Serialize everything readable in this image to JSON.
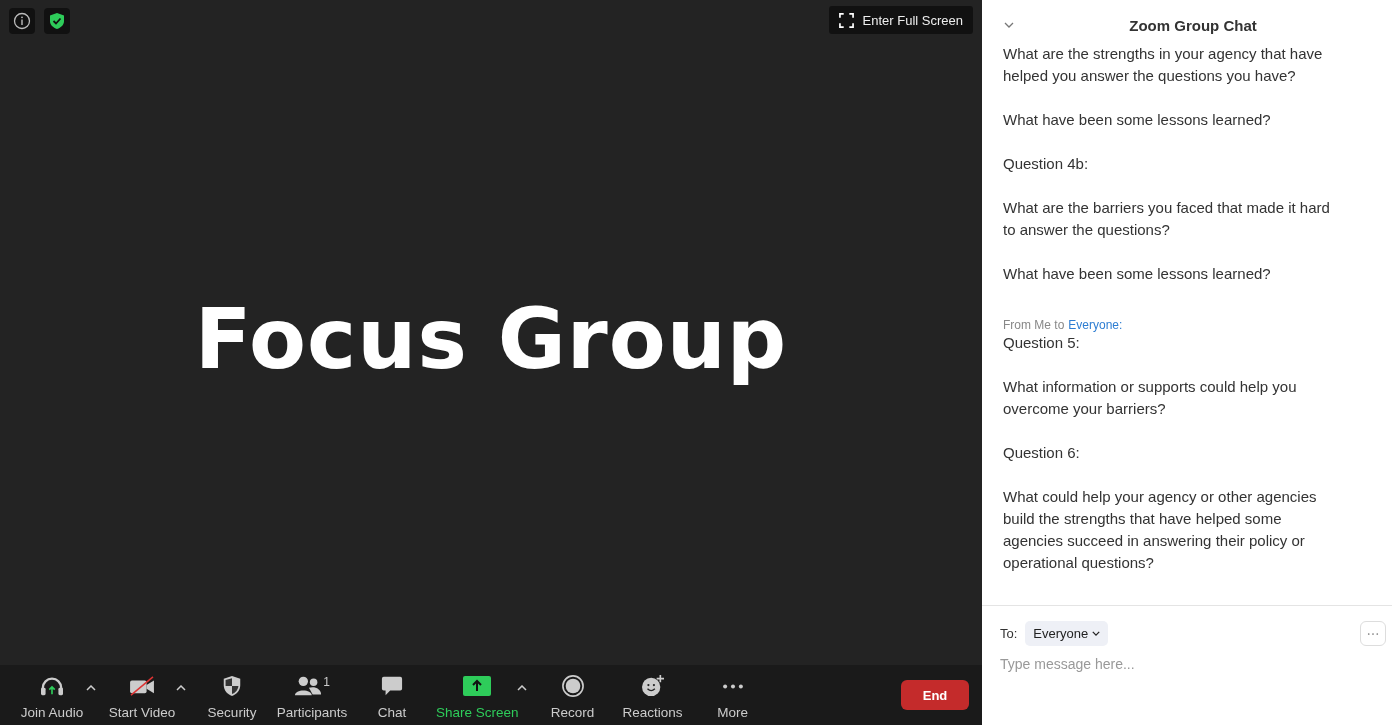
{
  "video": {
    "top_icons": [
      {
        "kind": "info"
      },
      {
        "kind": "shield"
      }
    ],
    "fullscreen_button": "Enter Full Screen",
    "title": "Focus Group"
  },
  "toolbar": [
    {
      "kind": "audio",
      "label": "Join Audio",
      "caret": true
    },
    {
      "kind": "video",
      "label": "Start Video",
      "caret": true
    },
    {
      "kind": "security",
      "label": "Security",
      "caret": false
    },
    {
      "kind": "participants",
      "label": "Participants",
      "caret": false,
      "count": "1"
    },
    {
      "kind": "chat",
      "label": "Chat",
      "caret": false
    },
    {
      "kind": "share",
      "label": "Share Screen",
      "caret": true
    },
    {
      "kind": "record",
      "label": "Record",
      "caret": false
    },
    {
      "kind": "reactions",
      "label": "Reactions",
      "caret": false
    },
    {
      "kind": "more",
      "label": "More",
      "caret": false
    }
  ],
  "end_button": "End",
  "chat": {
    "title": "Zoom Group Chat",
    "messages": [
      {
        "paragraphs": [
          "What are the strengths in your agency that have helped you answer the questions you have?",
          "What have been some lessons learned?",
          "Question 4b:",
          "What are the barriers you faced that made it hard to answer the questions?",
          "What have been some lessons learned?"
        ]
      },
      {
        "sender": "From Me to",
        "recipient": "Everyone:",
        "paragraphs": [
          "Question 5:",
          "What information or supports could help you overcome your barriers?",
          "Question 6:",
          "What could help your agency or other agencies build the strengths that have helped some agencies succeed in answering their policy or operational questions?"
        ]
      }
    ],
    "to_label": "To:",
    "recipient_select": "Everyone",
    "input": {
      "placeholder": "Type message here..."
    }
  }
}
